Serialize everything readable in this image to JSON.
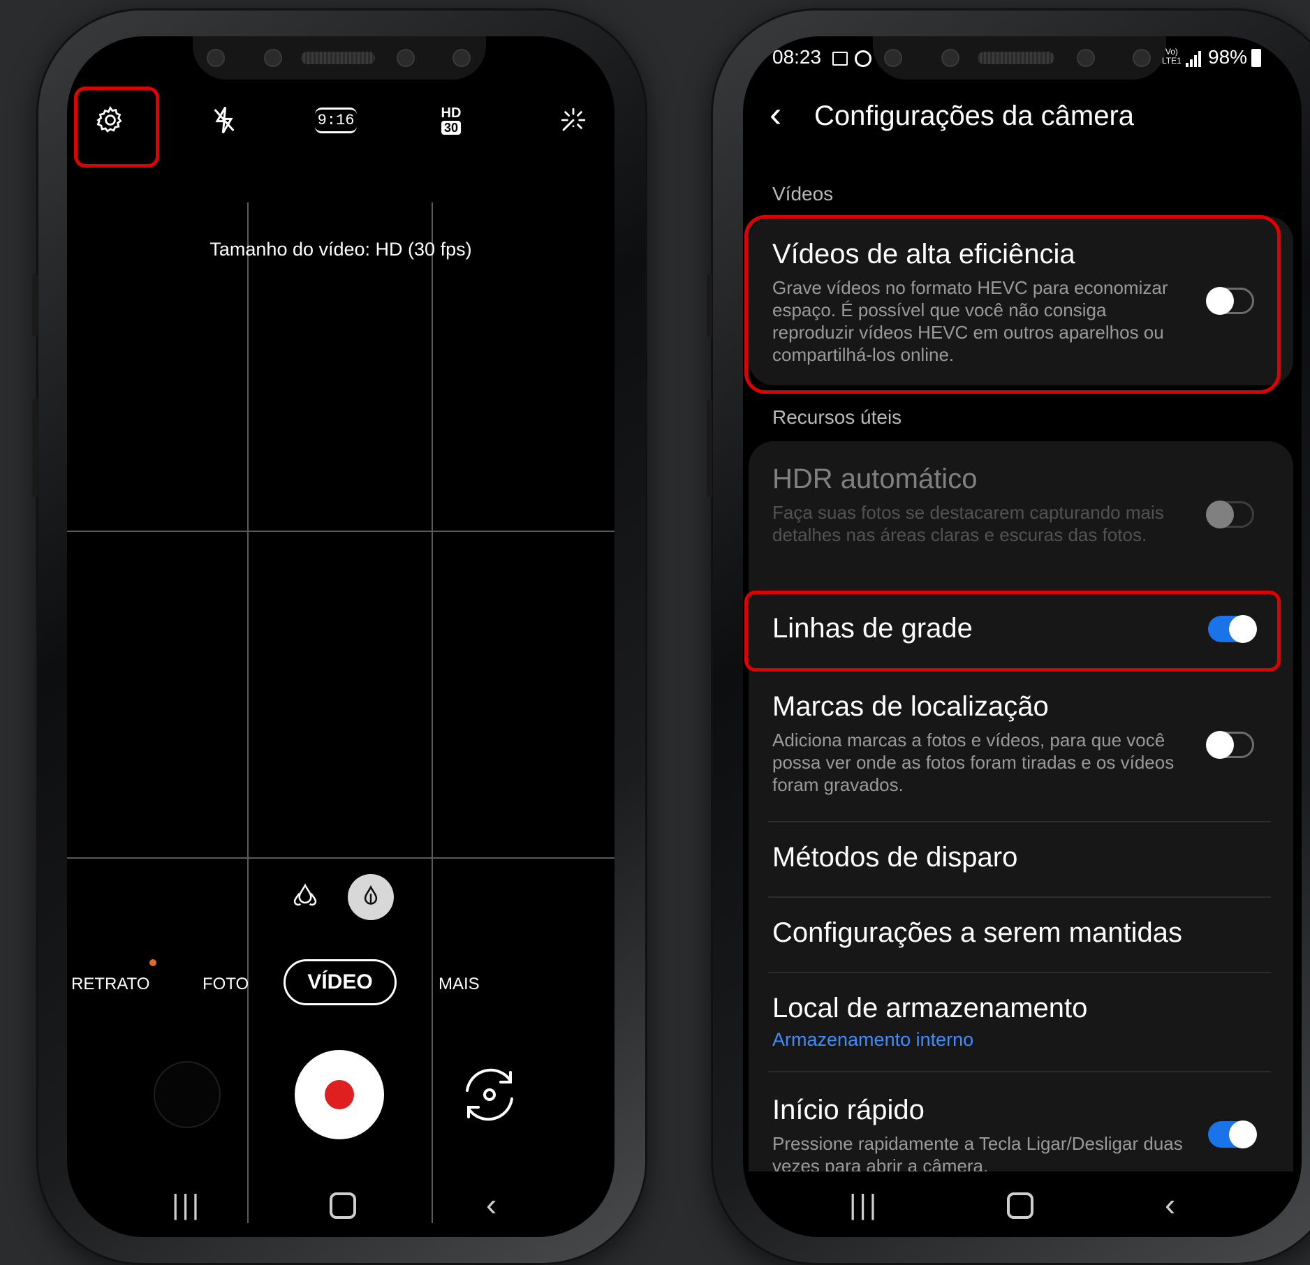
{
  "colors": {
    "highlight": "#e00000",
    "toggle_on": "#1a73e8",
    "record_dot": "#e02020",
    "link_blue": "#3f8cff",
    "orange_dot": "#e86a1c"
  },
  "camera": {
    "top_icons": [
      {
        "name": "gear-icon"
      },
      {
        "name": "flash-off-icon"
      },
      {
        "name": "ratio-icon",
        "label": "9:16"
      },
      {
        "name": "hd-icon",
        "label_top": "HD",
        "label_bottom": "30"
      },
      {
        "name": "sparkle-icon"
      }
    ],
    "video_size_text": "Tamanho do vídeo: HD (30 fps)",
    "modes": {
      "portrait": "RETRATO",
      "photo": "FOTO",
      "video": "VÍDEO",
      "more": "MAIS"
    },
    "filter_icons": [
      "filter-drops-icon",
      "filter-drops-selected-icon"
    ]
  },
  "settings": {
    "status": {
      "time": "08:23",
      "battery": "98%",
      "lte_top": "Vo)",
      "lte_bottom": "LTE1"
    },
    "header_title": "Configurações da câmera",
    "section_videos": "Vídeos",
    "hevc": {
      "title": "Vídeos de alta eficiência",
      "description": "Grave vídeos no formato HEVC para economizar espaço. É possível que você não consiga reproduzir vídeos HEVC em outros aparelhos ou compartilhá-los online.",
      "enabled": false
    },
    "section_useful": "Recursos úteis",
    "hdr": {
      "title": "HDR automático",
      "description": "Faça suas fotos se destacarem capturando mais detalhes nas áreas claras e escuras das fotos.",
      "enabled": false
    },
    "grid_lines": {
      "title": "Linhas de grade",
      "enabled": true
    },
    "location_tags": {
      "title": "Marcas de localização",
      "description": "Adiciona marcas a fotos e vídeos, para que você possa ver onde as fotos foram tiradas e os vídeos foram gravados.",
      "enabled": false
    },
    "shooting_methods": {
      "title": "Métodos de disparo"
    },
    "settings_to_keep": {
      "title": "Configurações a serem mantidas"
    },
    "storage": {
      "title": "Local de armazenamento",
      "value": "Armazenamento interno"
    },
    "quick_launch": {
      "title": "Início rápido",
      "description": "Pressione rapidamente a Tecla Ligar/Desligar duas vezes para abrir a câmera.",
      "enabled": true
    }
  }
}
